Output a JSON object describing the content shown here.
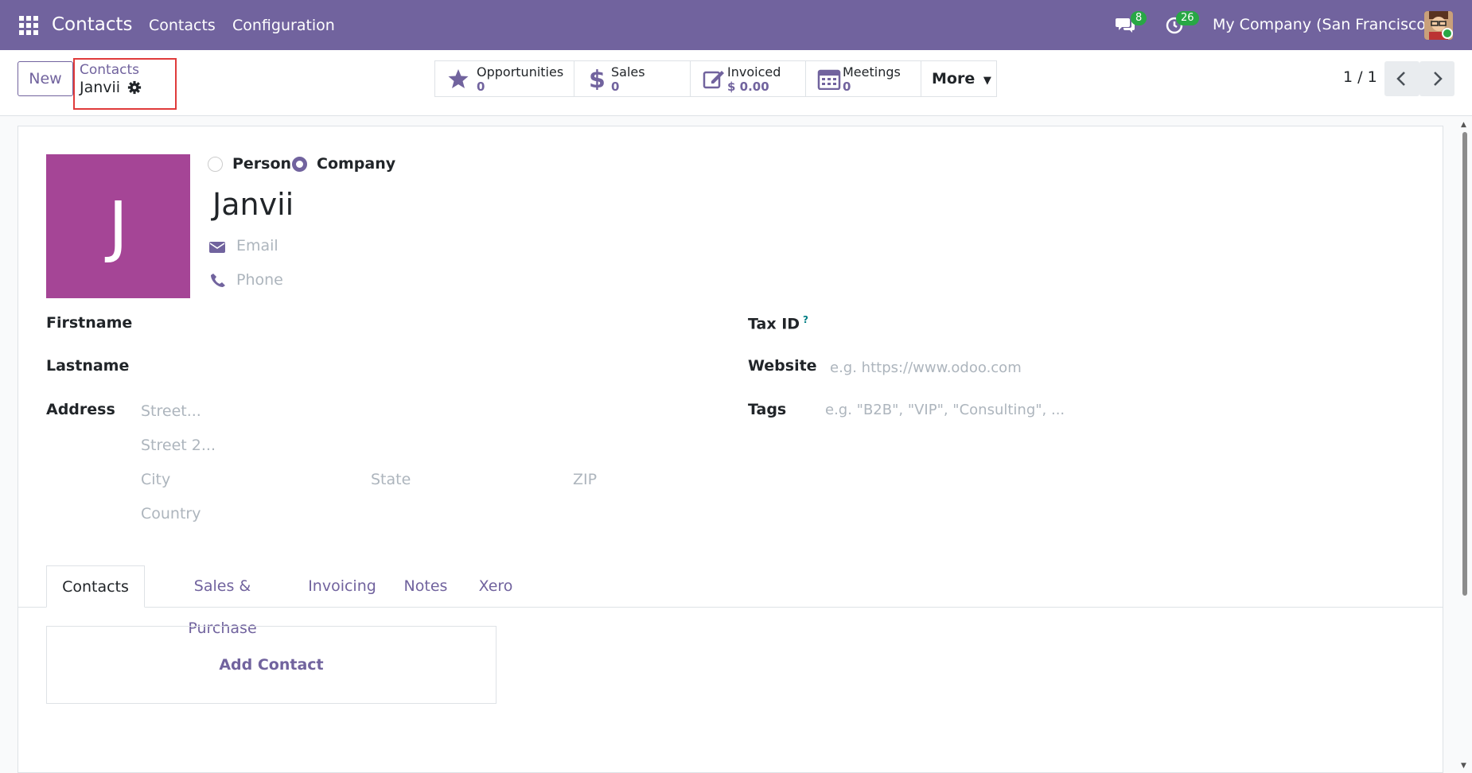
{
  "navbar": {
    "app_title": "Contacts",
    "menu": [
      "Contacts",
      "Configuration"
    ],
    "messages_count": "8",
    "activities_count": "26",
    "company": "My Company (San Francisco)"
  },
  "control": {
    "new_label": "New",
    "breadcrumb_parent": "Contacts",
    "breadcrumb_current": "Janvii",
    "smart_buttons": [
      {
        "label": "Opportunities",
        "value": "0",
        "icon": "star-icon"
      },
      {
        "label": "Sales",
        "value": "0",
        "icon": "dollar-icon"
      },
      {
        "label": "Invoiced",
        "value": "$ 0.00",
        "icon": "edit-icon"
      },
      {
        "label": "Meetings",
        "value": "0",
        "icon": "calendar-icon"
      }
    ],
    "more_label": "More",
    "pager": "1 / 1"
  },
  "form": {
    "avatar_letter": "J",
    "type_person": "Person",
    "type_company": "Company",
    "selected_type": "Company",
    "name": "Janvii",
    "email_placeholder": "Email",
    "phone_placeholder": "Phone",
    "firstname_label": "Firstname",
    "lastname_label": "Lastname",
    "address_label": "Address",
    "street_placeholder": "Street...",
    "street2_placeholder": "Street 2...",
    "city_placeholder": "City",
    "state_placeholder": "State",
    "zip_placeholder": "ZIP",
    "country_placeholder": "Country",
    "taxid_label": "Tax ID",
    "taxid_tip": "?",
    "website_label": "Website",
    "website_placeholder": "e.g. https://www.odoo.com",
    "tags_label": "Tags",
    "tags_placeholder": "e.g. \"B2B\", \"VIP\", \"Consulting\", ..."
  },
  "tabs": [
    "Contacts",
    "Sales & Purchase",
    "Invoicing",
    "Notes",
    "Xero"
  ],
  "active_tab": "Contacts",
  "add_contact_label": "Add Contact",
  "colors": {
    "brand": "#71639e",
    "avatar": "#a54596",
    "badge": "#28a745"
  }
}
